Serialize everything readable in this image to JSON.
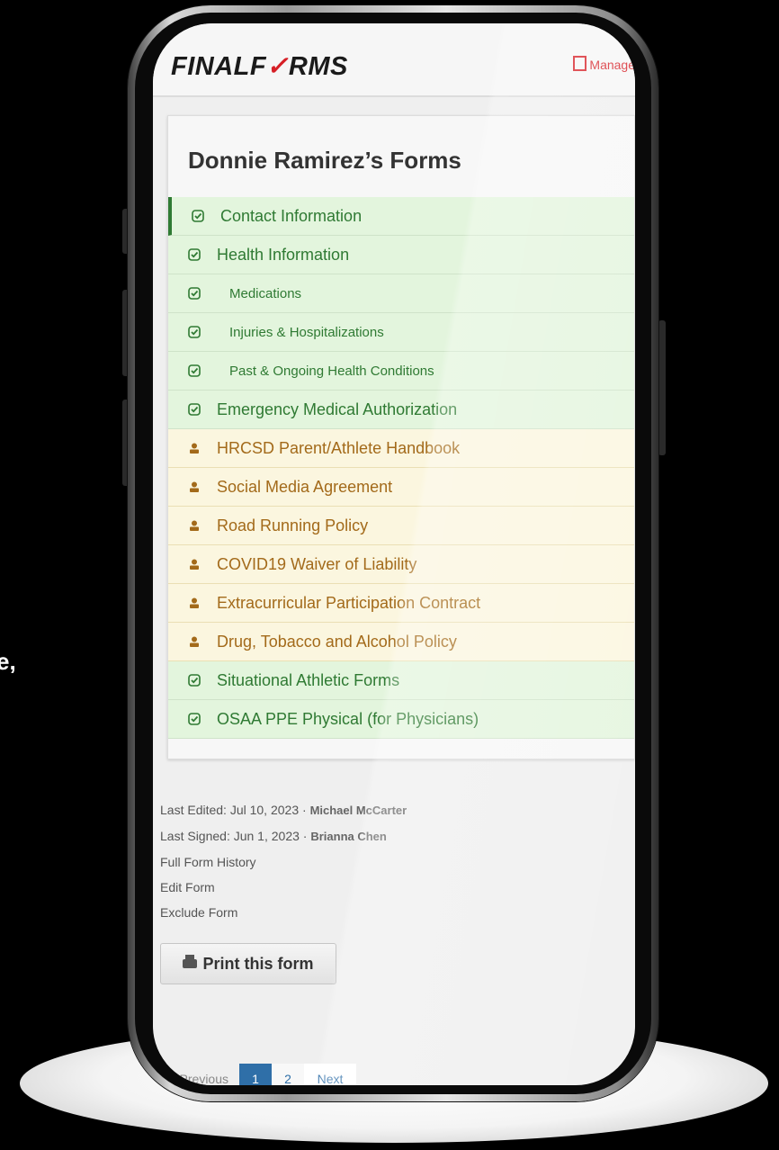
{
  "side_text": [
    "e,"
  ],
  "header": {
    "logo_prefix": "FINALF",
    "logo_check": "✓",
    "logo_suffix": "RMS",
    "manage_label": "Manage"
  },
  "card": {
    "title": "Donnie Ramirez’s Forms",
    "items": [
      {
        "label": "Contact Information",
        "status": "complete",
        "icon": "check-icon"
      },
      {
        "label": "Health Information",
        "status": "complete",
        "icon": "check-icon"
      },
      {
        "label": "Medications",
        "status": "complete",
        "icon": "check-icon"
      },
      {
        "label": "Injuries & Hospitalizations",
        "status": "complete",
        "icon": "check-icon"
      },
      {
        "label": "Past & Ongoing Health Conditions",
        "status": "complete",
        "icon": "check-icon"
      },
      {
        "label": "Emergency Medical Authorization",
        "status": "complete",
        "icon": "check-icon"
      },
      {
        "label": "HRCSD Parent/Athlete Handbook",
        "status": "pending",
        "icon": "person-icon"
      },
      {
        "label": "Social Media Agreement",
        "status": "pending",
        "icon": "person-icon"
      },
      {
        "label": "Road Running Policy",
        "status": "pending",
        "icon": "person-icon"
      },
      {
        "label": "COVID19 Waiver of Liability",
        "status": "pending",
        "icon": "person-icon"
      },
      {
        "label": "Extracurricular Participation Contract",
        "status": "pending",
        "icon": "person-icon"
      },
      {
        "label": "Drug, Tobacco and Alcohol Policy",
        "status": "pending",
        "icon": "person-icon"
      },
      {
        "label": "Situational Athletic Forms",
        "status": "complete",
        "icon": "check-icon"
      },
      {
        "label": "OSAA PPE Physical (for Physicians)",
        "status": "complete",
        "icon": "check-icon"
      }
    ]
  },
  "meta": {
    "last_edited_label": "Last Edited: Jul 10, 2023 ·",
    "last_edited_by": "Michael McCarter",
    "last_signed_label": "Last Signed: Jun 1, 2023 ·",
    "last_signed_by": "Brianna Chen",
    "full_history": "Full Form History",
    "edit_form": "Edit Form",
    "exclude_form": "Exclude Form"
  },
  "print_button": "Print this form",
  "pagination": {
    "previous": "Previous",
    "pages": [
      "1",
      "2"
    ],
    "active_page": "1",
    "next": "Next"
  },
  "colors": {
    "brand_red": "#d61f26",
    "complete_green": "#2f7a33",
    "pending_orange": "#a36a1a",
    "pagination_blue": "#2f6fa8"
  }
}
